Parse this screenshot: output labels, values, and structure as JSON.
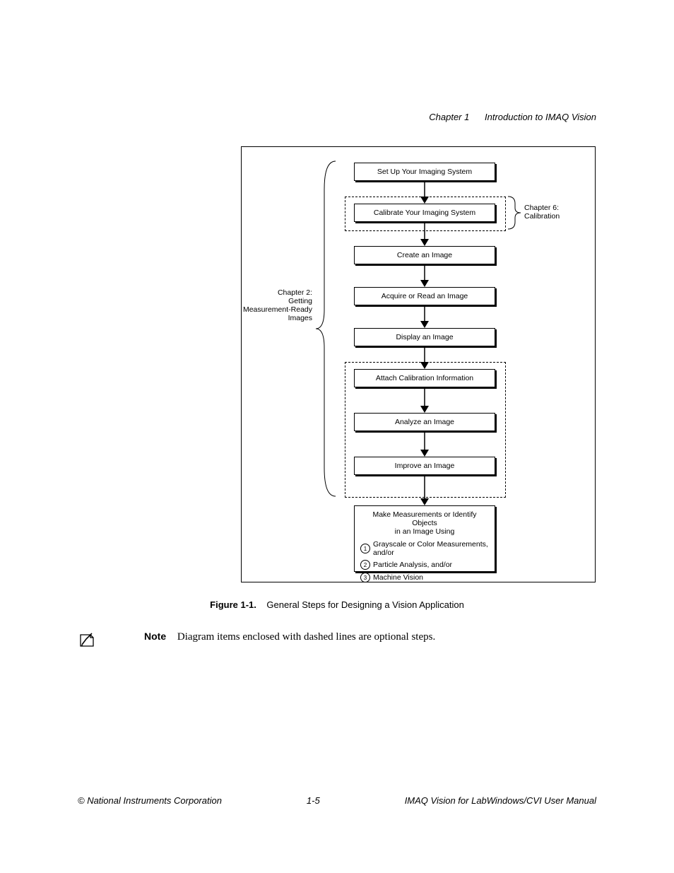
{
  "header": {
    "chapter": "Chapter 1",
    "title": "Introduction to IMAQ Vision"
  },
  "labels": {
    "chapter2_l1": "Chapter 2:",
    "chapter2_l2": "Getting",
    "chapter2_l3": "Measurement-Ready",
    "chapter2_l4": "Images",
    "chapter6_l1": "Chapter 6:",
    "chapter6_l2": "Calibration"
  },
  "boxes": {
    "b1": "Set Up Your Imaging System",
    "b2": "Calibrate Your Imaging System",
    "b3": "Create an Image",
    "b4": "Acquire or Read an Image",
    "b5": "Display an Image",
    "b6": "Attach Calibration Information",
    "b7": "Analyze an Image",
    "b8": "Improve an Image"
  },
  "finalbox": {
    "title_l1": "Make Measurements or Identify Objects",
    "title_l2": "in an Image Using",
    "row1": "Grayscale or Color Measurements, and/or",
    "row2": "Particle Analysis, and/or",
    "row3": "Machine Vision",
    "n1": "1",
    "n2": "2",
    "n3": "3"
  },
  "caption": {
    "fig": "Figure 1-1.",
    "text": "General Steps for Designing a Vision Application"
  },
  "note": {
    "label": "Note",
    "text": "Diagram items enclosed with dashed lines are optional steps."
  },
  "footer": {
    "left": "© National Instruments Corporation",
    "center": "1-5",
    "right": "IMAQ Vision for LabWindows/CVI User Manual"
  }
}
